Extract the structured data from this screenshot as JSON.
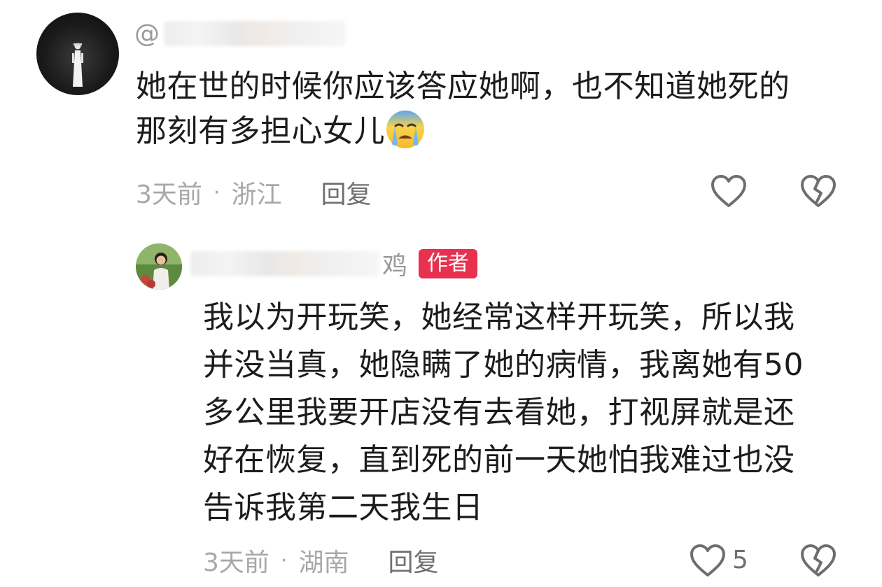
{
  "comment": {
    "username_prefix": "@",
    "text_line1": "她在世的时候你应该答应她啊，也不知道她死的",
    "text_line2": "那刻有多担心女儿",
    "emoji": "crying-face",
    "time": "3天前",
    "location": "浙江",
    "separator": "·",
    "reply_label": "回复"
  },
  "reply": {
    "username_suffix": "鸡",
    "badge": "作者",
    "lines": [
      "我以为开玩笑，她经常这样开玩笑，所以我",
      "并没当真，她隐瞒了她的病情，我离她有50",
      "多公里我要开店没有去看她，打视屏就是还",
      "好在恢复，直到死的前一天她怕我难过也没",
      "告诉我第二天我生日"
    ],
    "time": "3天前",
    "location": "湖南",
    "separator": "·",
    "reply_label": "回复",
    "like_count": "5"
  },
  "colors": {
    "badge": "#e8304f",
    "meta_text": "#a8a8a8",
    "body_text": "#1c1c1c",
    "icon_stroke": "#6e6e6e"
  }
}
